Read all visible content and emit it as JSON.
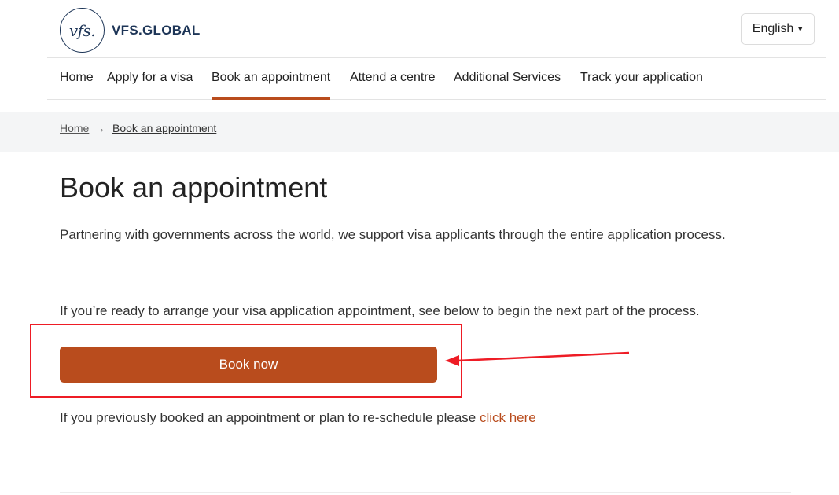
{
  "brand": {
    "logo_mark": "vfs.",
    "name": "VFS.GLOBAL"
  },
  "language": {
    "selected": "English"
  },
  "nav": {
    "items": [
      {
        "label": "Home"
      },
      {
        "label": "Apply for a visa"
      },
      {
        "label": "Book an appointment",
        "active": true
      },
      {
        "label": "Attend a centre"
      },
      {
        "label": "Additional Services"
      },
      {
        "label": "Track your application"
      }
    ]
  },
  "breadcrumb": {
    "home": "Home",
    "current": "Book an appointment"
  },
  "main": {
    "title": "Book an appointment",
    "intro": "Partnering with governments across the world, we support visa applicants through the entire application process.",
    "ready_text": "If you’re ready to arrange your visa application appointment, see below to begin the next part of the process.",
    "book_button": "Book now",
    "reschedule_text": "If you previously booked an appointment or plan to re-schedule please ",
    "reschedule_link": "click here"
  },
  "colors": {
    "accent": "#b94c1d",
    "brand_navy": "#1d3557",
    "annotation_red": "#ee1c25"
  },
  "icons": {
    "breadcrumb_separator": "arrow-right-icon",
    "language_caret": "caret-down-icon",
    "annotation": "red-arrow-icon"
  }
}
